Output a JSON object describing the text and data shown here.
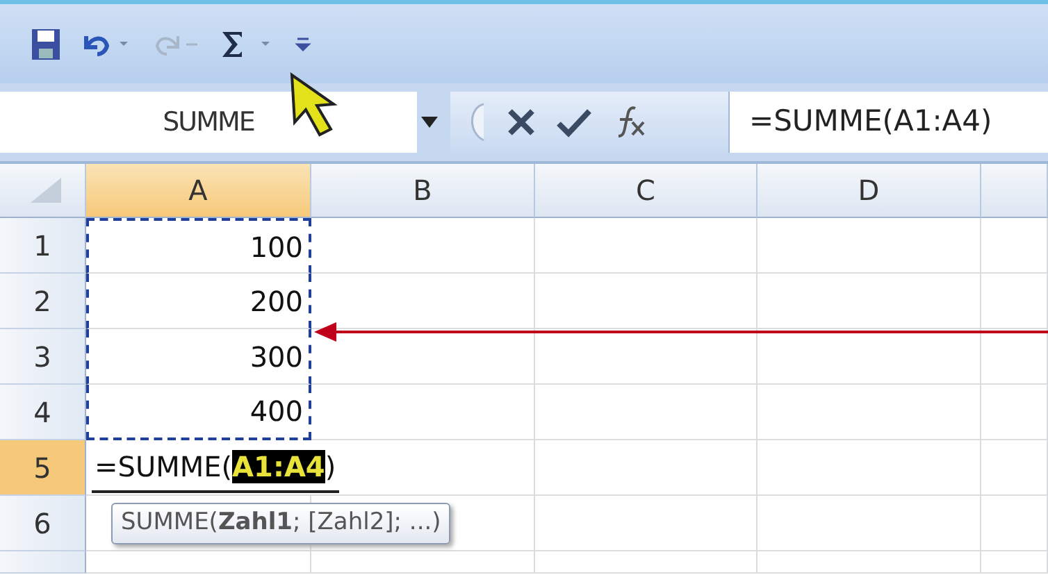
{
  "quick_access_toolbar": [
    {
      "kind": "save",
      "disabled": false
    },
    {
      "kind": "undo",
      "disabled": false
    },
    {
      "kind": "redo",
      "disabled": true
    },
    {
      "kind": "autosum",
      "disabled": false
    },
    {
      "kind": "customize",
      "disabled": false
    }
  ],
  "name_box": {
    "value": "SUMME"
  },
  "formula_bar": {
    "value": "=SUMME(A1:A4)"
  },
  "columns": [
    {
      "label": "A",
      "selected": true
    },
    {
      "label": "B",
      "selected": false
    },
    {
      "label": "C",
      "selected": false
    },
    {
      "label": "D",
      "selected": false
    }
  ],
  "rows": [
    {
      "label": "1",
      "selected": false,
      "in_copy_range": true,
      "cell_a": "100"
    },
    {
      "label": "2",
      "selected": false,
      "in_copy_range": true,
      "cell_a": "200"
    },
    {
      "label": "3",
      "selected": false,
      "in_copy_range": true,
      "cell_a": "300"
    },
    {
      "label": "4",
      "selected": false,
      "in_copy_range": true,
      "cell_a": "400"
    },
    {
      "label": "5",
      "selected": true,
      "in_copy_range": false,
      "editor": [
        {
          "kind": "text",
          "text": "=SUMME("
        },
        {
          "kind": "reference",
          "text": "A1:A4"
        },
        {
          "kind": "text",
          "text": ")"
        }
      ]
    },
    {
      "label": "6",
      "selected": false,
      "in_copy_range": false,
      "tooltip": "SUMME(**Zahl1**; [Zahl2]; ...)"
    }
  ]
}
